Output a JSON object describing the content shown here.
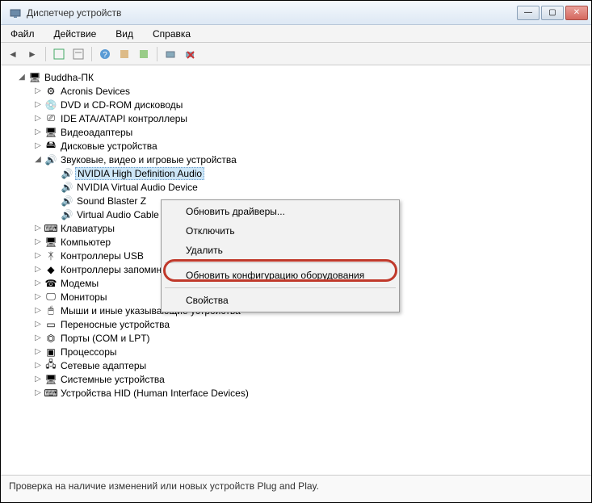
{
  "window": {
    "title": "Диспетчер устройств"
  },
  "menu": {
    "file": "Файл",
    "action": "Действие",
    "view": "Вид",
    "help": "Справка"
  },
  "tree": {
    "root": "Buddha-ПК",
    "nodes": [
      {
        "label": "Acronis Devices",
        "icon": "device"
      },
      {
        "label": "DVD и CD-ROM дисководы",
        "icon": "disc"
      },
      {
        "label": "IDE ATA/ATAPI контроллеры",
        "icon": "ide"
      },
      {
        "label": "Видеоадаптеры",
        "icon": "display"
      },
      {
        "label": "Дисковые устройства",
        "icon": "disk"
      }
    ],
    "audio": {
      "label": "Звуковые, видео и игровые устройства",
      "children": [
        "NVIDIA High Definition Audio",
        "NVIDIA Virtual Audio Device",
        "Sound Blaster Z",
        "Virtual Audio Cable"
      ]
    },
    "nodes2": [
      {
        "label": "Клавиатуры"
      },
      {
        "label": "Компьютер"
      },
      {
        "label": "Контроллеры USB"
      },
      {
        "label": "Контроллеры запоминающих устройств"
      },
      {
        "label": "Модемы"
      },
      {
        "label": "Мониторы"
      },
      {
        "label": "Мыши и иные указывающие устройства"
      },
      {
        "label": "Переносные устройства"
      },
      {
        "label": "Порты (COM и LPT)"
      },
      {
        "label": "Процессоры"
      },
      {
        "label": "Сетевые адаптеры"
      },
      {
        "label": "Системные устройства"
      },
      {
        "label": "Устройства HID (Human Interface Devices)"
      }
    ]
  },
  "context": {
    "update_drivers": "Обновить драйверы...",
    "disable": "Отключить",
    "remove": "Удалить",
    "scan": "Обновить конфигурацию оборудования",
    "properties": "Свойства"
  },
  "status": "Проверка на наличие изменений или новых устройств Plug and Play."
}
